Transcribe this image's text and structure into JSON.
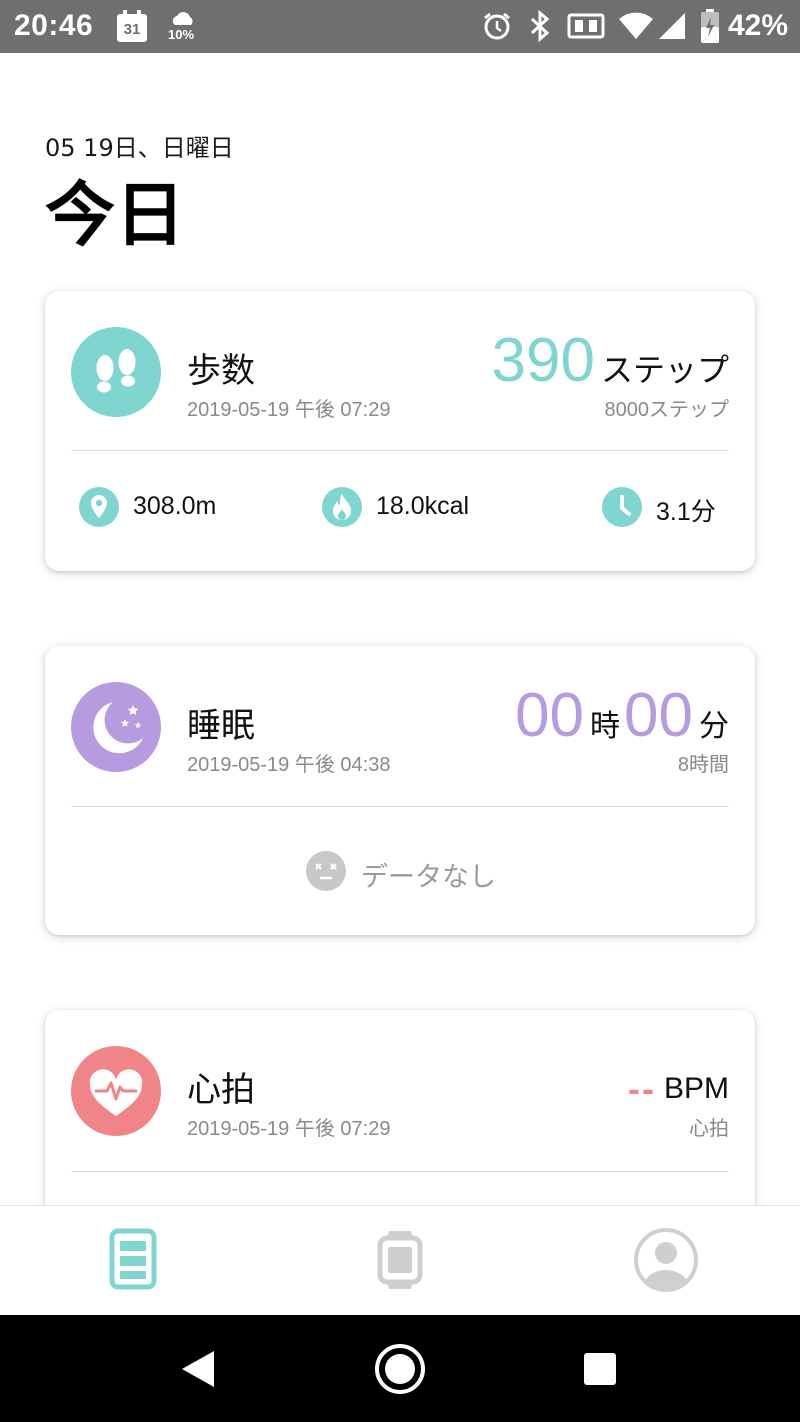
{
  "status_bar": {
    "time": "20:46",
    "calendar_day": "31",
    "weather_percent": "10%",
    "battery_percent": "42%"
  },
  "header": {
    "date": "05 19日、日曜日",
    "title": "今日"
  },
  "steps_card": {
    "title": "歩数",
    "timestamp": "2019-05-19 午後 07:29",
    "value": "390",
    "unit": "ステップ",
    "goal": "8000ステップ",
    "accent": "#7fd6d0",
    "stats": {
      "distance": "308.0m",
      "calories": "18.0kcal",
      "duration": "3.1分"
    }
  },
  "sleep_card": {
    "title": "睡眠",
    "timestamp": "2019-05-19 午後 04:38",
    "hours": "00",
    "hours_unit": "時",
    "minutes": "00",
    "minutes_unit": "分",
    "goal": "8時間",
    "no_data": "データなし",
    "accent": "#b79be0"
  },
  "heart_card": {
    "title": "心拍",
    "timestamp": "2019-05-19 午後 07:29",
    "value": "--",
    "unit": "BPM",
    "subtitle": "心拍",
    "accent": "#f08489"
  },
  "bottom_nav": {
    "tabs": [
      {
        "icon": "dashboard-icon",
        "active": true
      },
      {
        "icon": "watch-icon",
        "active": false
      },
      {
        "icon": "profile-icon",
        "active": false
      }
    ]
  },
  "system_nav": [
    "back-icon",
    "home-icon",
    "recents-icon"
  ]
}
